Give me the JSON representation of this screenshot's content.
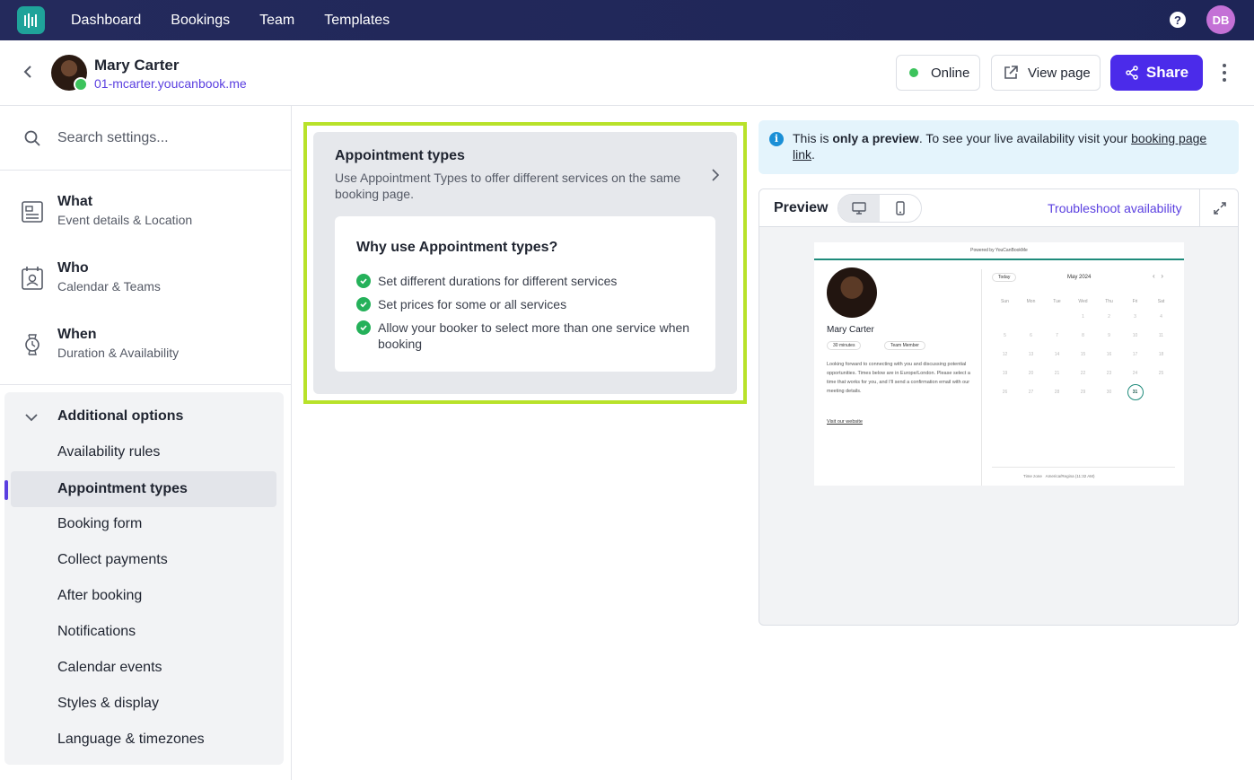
{
  "nav": {
    "links": [
      "Dashboard",
      "Bookings",
      "Team",
      "Templates"
    ],
    "help_icon": "question-circle-icon",
    "user_initials": "DB"
  },
  "header": {
    "name": "Mary Carter",
    "link": "01-mcarter.youcanbook.me",
    "status_label": "Online",
    "view_label": "View page",
    "share_label": "Share"
  },
  "sidebar": {
    "search_placeholder": "Search settings...",
    "sections": [
      {
        "title": "What",
        "subtitle": "Event details & Location",
        "icon": "document-icon"
      },
      {
        "title": "Who",
        "subtitle": "Calendar & Teams",
        "icon": "contact-card-icon"
      },
      {
        "title": "When",
        "subtitle": "Duration & Availability",
        "icon": "watch-icon"
      }
    ],
    "additional": {
      "title": "Additional options",
      "items": [
        "Availability rules",
        "Appointment types",
        "Booking form",
        "Collect payments",
        "After booking",
        "Notifications",
        "Calendar events",
        "Styles & display",
        "Language & timezones"
      ],
      "active": "Appointment types"
    }
  },
  "main": {
    "card_title": "Appointment types",
    "card_desc": "Use Appointment Types to offer different services on the same booking page.",
    "why_title": "Why use Appointment types?",
    "bullets": [
      "Set different durations for different services",
      "Set prices for some or all services",
      "Allow your booker to select more than one service when booking"
    ]
  },
  "notice": {
    "pre": "This is ",
    "bold": "only a preview",
    "mid": ". To see your live availability visit your ",
    "link": "booking page link",
    "end": "."
  },
  "preview": {
    "title": "Preview",
    "troubleshoot": "Troubleshoot availability",
    "mini": {
      "powered": "Powered by YouCanBookMe",
      "name": "Mary Carter",
      "duration": "30 minutes",
      "team": "Team Member",
      "desc": "Looking forward to connecting with you and discussing potential opportunities. Times below are in Europe/London. Please select a time that works for you, and I'll send a confirmation email with our meeting details.",
      "website": "Visit our website",
      "today": "Today",
      "month": "May 2024",
      "weekdays": [
        "Sun",
        "Mon",
        "Tue",
        "Wed",
        "Thu",
        "Fri",
        "Sat"
      ],
      "selected_day": "31",
      "timezone_label": "Time zone",
      "timezone": "America/Regina (11:32 AM)"
    }
  },
  "colors": {
    "nav_bg": "#242a5c",
    "accent": "#4b2bea",
    "highlight": "#b8e22a",
    "success": "#25b15a",
    "brand_teal": "#1fa39a"
  }
}
